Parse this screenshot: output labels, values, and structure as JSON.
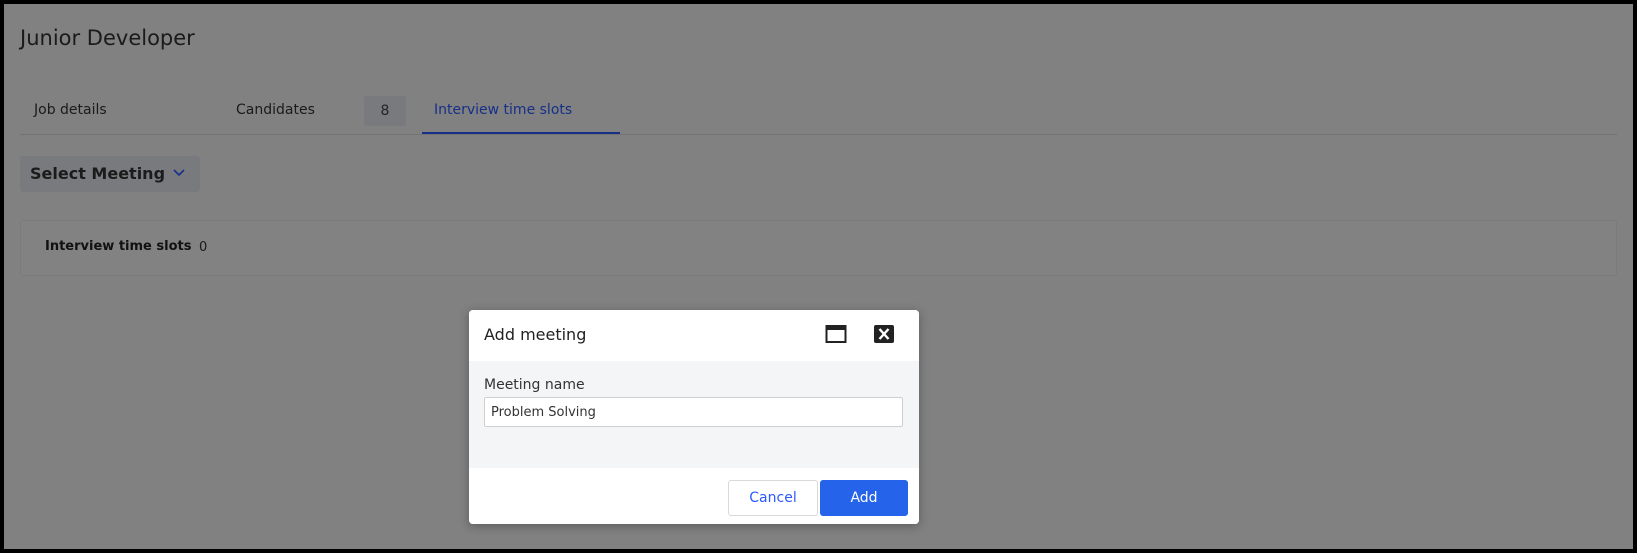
{
  "job": {
    "title": "Junior Developer"
  },
  "tabs": [
    {
      "label": "Job details",
      "active": false
    },
    {
      "label": "Candidates",
      "count": "8",
      "active": false
    },
    {
      "label": "Interview time slots",
      "active": true
    }
  ],
  "select_meeting": {
    "label": "Select Meeting",
    "icon": "chevron-down-icon"
  },
  "slots_card": {
    "title": "Interview time slots",
    "count": "0"
  },
  "modal": {
    "title": "Add meeting",
    "maximize_icon": "window-maximize-icon",
    "close_icon": "close-icon",
    "field_label": "Meeting name",
    "field_value": "Problem Solving",
    "cancel_label": "Cancel",
    "add_label": "Add"
  },
  "colors": {
    "accent": "#2b59ff",
    "primary_button": "#2563eb",
    "overlay": "rgba(0,0,0,0.47)"
  }
}
